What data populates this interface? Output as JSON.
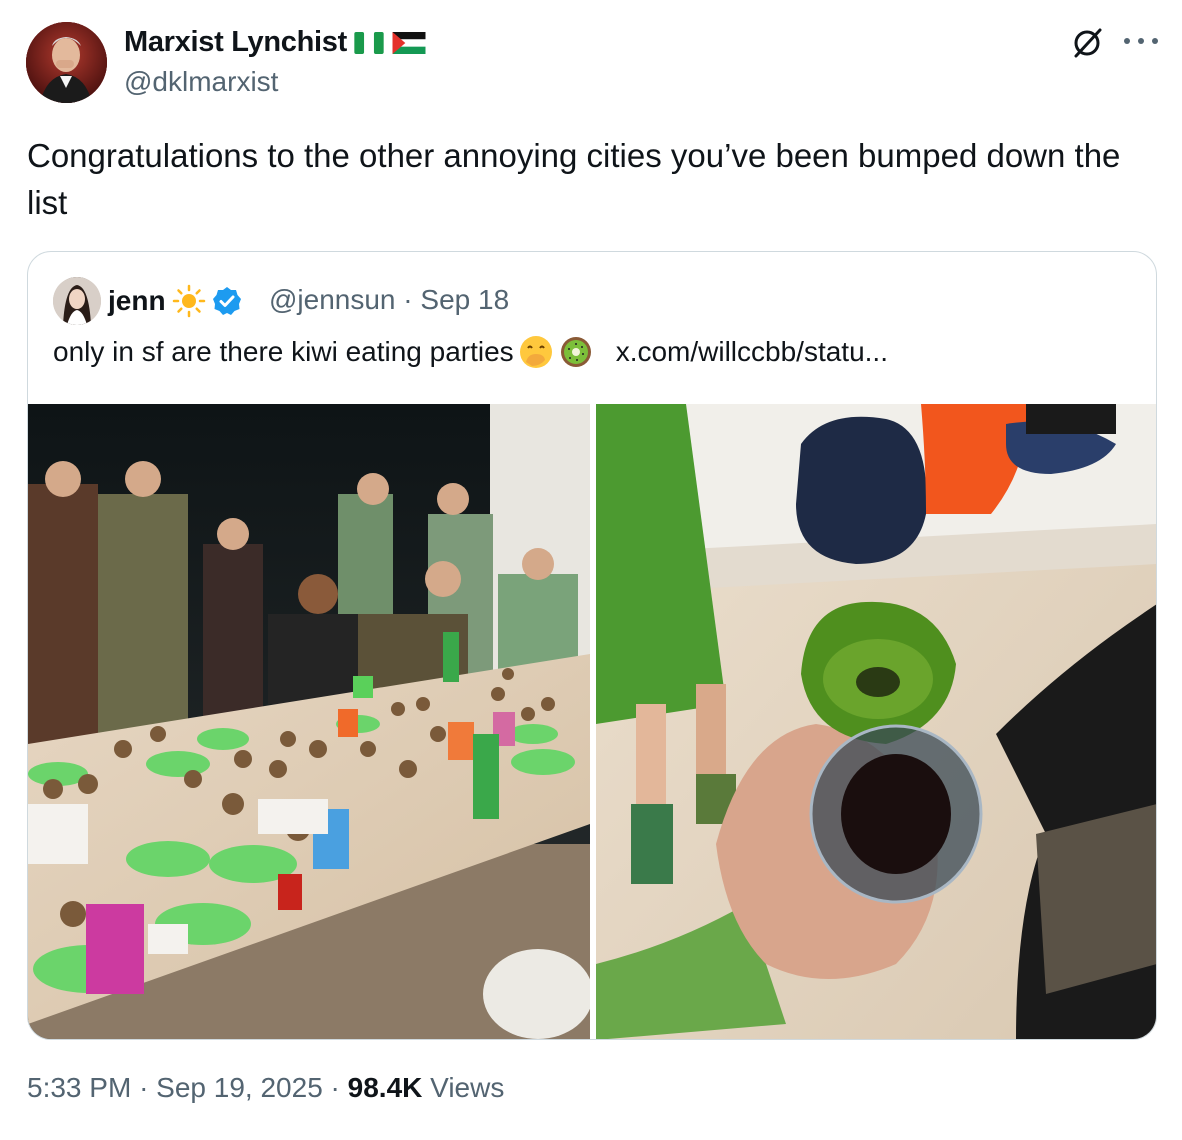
{
  "author": {
    "display_name": "Marxist Lynchist",
    "handle": "@dklmarxist",
    "flags": [
      "nigeria-flag-icon",
      "palestine-flag-icon"
    ]
  },
  "tweet": {
    "text": "Congratulations to the other annoying cities you’ve been bumped down the list"
  },
  "quote": {
    "name": "jenn",
    "name_emoji": "sun-emoji",
    "verified": true,
    "handle": "@jennsun",
    "separator": "·",
    "date": "Sep 18",
    "text": "only in sf are there kiwi eating parties",
    "emojis": [
      "face-with-hand-over-mouth-emoji",
      "kiwi-emoji"
    ],
    "link": "x.com/willccbb/statu..."
  },
  "footer": {
    "time": "5:33 PM",
    "date": "Sep 19, 2025",
    "views_count": "98.4K",
    "views_label": "Views",
    "separator": "·"
  },
  "colors": {
    "text": "#0f1419",
    "secondary": "#536471",
    "border": "#cfd9de",
    "verified": "#1d9bf0"
  }
}
